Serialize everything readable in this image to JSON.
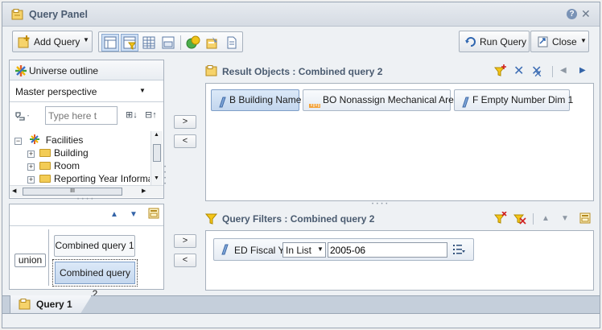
{
  "window": {
    "title": "Query Panel"
  },
  "toolbar": {
    "add_query_label": "Add Query",
    "run_query_label": "Run Query",
    "close_label": "Close"
  },
  "universe": {
    "title": "Universe outline",
    "perspective": "Master perspective",
    "search_placeholder": "Type here t",
    "tree_root": "Facilities",
    "tree_items": [
      "Building",
      "Room",
      "Reporting Year Informa"
    ]
  },
  "combine": {
    "operator": "union",
    "queries": [
      "Combined query 1",
      "Combined query 2"
    ]
  },
  "result_objects": {
    "title": "Result Objects : Combined query 2",
    "items": [
      {
        "label": "B Building Name",
        "icon": "dimension-icon",
        "selected": true
      },
      {
        "label": "BO Nonassign Mechanical Area",
        "icon": "measure-icon",
        "selected": false
      },
      {
        "label": "F Empty Number Dim 1",
        "icon": "dimension-icon",
        "selected": false
      }
    ]
  },
  "query_filters": {
    "title": "Query Filters : Combined query 2",
    "filter": {
      "object": "ED Fiscal Yr",
      "operator": "In List",
      "value": "2005-06"
    }
  },
  "tabs": [
    {
      "label": "Query 1"
    }
  ],
  "arrows": {
    "right": ">",
    "left": "<"
  },
  "scrollbar_mark": "III"
}
